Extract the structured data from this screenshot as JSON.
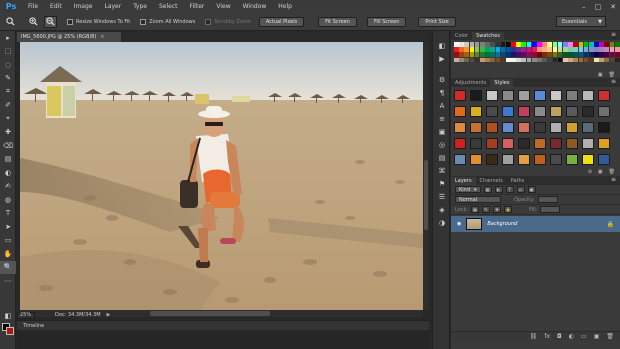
{
  "app": {
    "logo": "Ps"
  },
  "menu": [
    "File",
    "Edit",
    "Image",
    "Layer",
    "Type",
    "Select",
    "Filter",
    "View",
    "Window",
    "Help"
  ],
  "window_controls": [
    "–",
    "□",
    "✕"
  ],
  "options": {
    "resize_windows": "Resize Windows To Fit",
    "zoom_all": "Zoom All Windows",
    "scrubby": "Scrubby Zoom",
    "actual_pixels": "Actual Pixels",
    "fit_screen": "Fit Screen",
    "fill_screen": "Fill Screen",
    "print_size": "Print Size",
    "workspace": "Essentials"
  },
  "document": {
    "tab_title": "IMG_5600.JPG @ 25% (RGB/8)",
    "zoom": "25%",
    "doc_info": "Doc: 34.3M/34.3M"
  },
  "timeline": "Timeline",
  "panels": {
    "color_tabs": [
      "Color",
      "Swatches"
    ],
    "style_tabs": [
      "Adjustments",
      "Styles"
    ],
    "layer_tabs": [
      "Layers",
      "Channels",
      "Paths"
    ],
    "kind": "Kind",
    "blend_mode": "Normal",
    "opacity_label": "Opacity:",
    "lock_label": "Lock:",
    "fill_label": "Fill:",
    "background_layer": "Background"
  },
  "swatch_colors": [
    "#ffffff",
    "#e6e6e6",
    "#cccccc",
    "#b3b3b3",
    "#999999",
    "#808080",
    "#666666",
    "#4d4d4d",
    "#333333",
    "#1a1a1a",
    "#000000",
    "#ff0000",
    "#ffff00",
    "#00ff00",
    "#00ffff",
    "#0000ff",
    "#ff00ff",
    "#ff8080",
    "#ffff80",
    "#80ff80",
    "#80ffff",
    "#8080ff",
    "#ff80ff",
    "#c00000",
    "#c0c000",
    "#00c000",
    "#00c0c0",
    "#0000c0",
    "#c000c0",
    "#800000",
    "#808000",
    "#008000",
    "#ed1c24",
    "#f26522",
    "#f7941d",
    "#fff200",
    "#8dc63f",
    "#39b54a",
    "#00a651",
    "#00a99d",
    "#00aeef",
    "#0072bc",
    "#0054a6",
    "#2e3192",
    "#662d91",
    "#92278f",
    "#ec008c",
    "#ed145b",
    "#f69679",
    "#f9ad81",
    "#fdc68a",
    "#fff799",
    "#c4df9b",
    "#a3d39c",
    "#82ca9c",
    "#7accc8",
    "#6dcff6",
    "#7da7d9",
    "#8393ca",
    "#8781bd",
    "#a186be",
    "#bd8cbf",
    "#f49ac1",
    "#f5989d",
    "#9e0b0f",
    "#a0410d",
    "#a36209",
    "#aba000",
    "#598527",
    "#1a7b30",
    "#007236",
    "#00746b",
    "#0076a3",
    "#004b80",
    "#003471",
    "#1b1464",
    "#440e62",
    "#630460",
    "#9e005d",
    "#9e0039",
    "#790000",
    "#7b2e00",
    "#7d4900",
    "#827b00",
    "#406618",
    "#005e20",
    "#005826",
    "#005952",
    "#005b7f",
    "#003663",
    "#002157",
    "#0d004c",
    "#32004b",
    "#4b0049",
    "#7b0046",
    "#7a0026",
    "#c7b299",
    "#998675",
    "#736357",
    "#534741",
    "#37302a",
    "#c69c6d",
    "#a67c52",
    "#8c6239",
    "#754c24",
    "#603913",
    "#ffffff",
    "#f2f2f2",
    "#d9d9d9",
    "#bfbfbf",
    "#a6a6a6",
    "#8c8c8c",
    "#737373",
    "#595959",
    "#404040",
    "#262626",
    "#0d0d0d",
    "#e8c3b0",
    "#d2a57f",
    "#b5834b",
    "#9c6b3c",
    "#7d4f29",
    "#5e3a1c",
    "#efdfbf",
    "#c0a171",
    "#8b6f47",
    "#5a4630",
    "#2b2117"
  ],
  "style_colors": [
    "#d12a2a",
    "#1a1a1a",
    "#c8c8c8",
    "#8a8a8a",
    "#a0a0a0",
    "#5a8ad6",
    "#c9c9c9",
    "#7d7d7d",
    "#b8b8b8",
    "#cc3030",
    "#e06a1a",
    "#d9b020",
    "#4a4a4a",
    "#3a7ad0",
    "#c04060",
    "#8a8a8a",
    "#c0a060",
    "#5a5a5a",
    "#2a2a2a",
    "#707070",
    "#e08a40",
    "#c87030",
    "#b05020",
    "#6a8ad0",
    "#d07060",
    "#3a3a3a",
    "#b0b0b0",
    "#d0a030",
    "#5a6a7a",
    "#1a1a1a",
    "#cc2222",
    "#3a3a3a",
    "#a04020",
    "#d46060",
    "#2a2a2a",
    "#c06a2a",
    "#7a2a2a",
    "#8a5a2a",
    "#b0b0b0",
    "#e0a020",
    "#6a8ab0",
    "#e09030",
    "#3a2a1a",
    "#a0a0a0",
    "#e0a040",
    "#c06020",
    "#4a4a4a",
    "#7ab040",
    "#f0e010",
    "#305a9a"
  ],
  "tools": [
    "▸",
    "⬚",
    "◌",
    "✎",
    "⌗",
    "✐",
    "⌖",
    "✚",
    "⌫",
    "▤",
    "◐",
    "✍",
    "◍",
    "T",
    "➤",
    "▭",
    "✋",
    "🔍",
    "⋯",
    "◧"
  ],
  "dock_icons": [
    "◧",
    "▶",
    "⚙",
    "¶",
    "A",
    "≡",
    "▣",
    "◎",
    "▤",
    "⌘",
    "⚑",
    "☰",
    "◈",
    "◑"
  ]
}
